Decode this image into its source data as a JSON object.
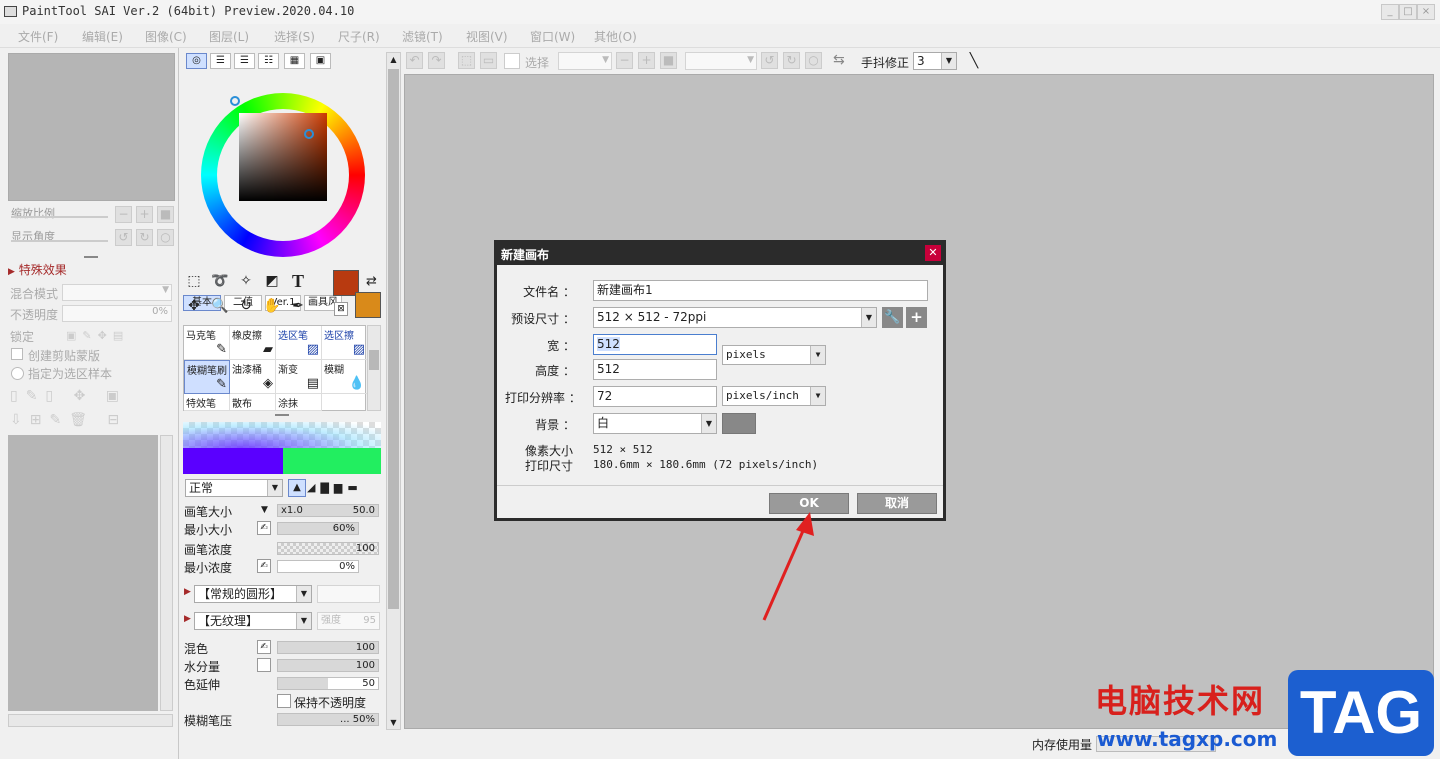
{
  "app": {
    "title": "PaintTool SAI Ver.2 (64bit) Preview.2020.04.10"
  },
  "menu": [
    "文件(F)",
    "编辑(E)",
    "图像(C)",
    "图层(L)",
    "选择(S)",
    "尺子(R)",
    "滤镜(T)",
    "视图(V)",
    "窗口(W)",
    "其他(O)"
  ],
  "left": {
    "zoom_label": "缩放比例",
    "angle_label": "显示角度",
    "special_effects": "特殊效果",
    "blend_mode": "混合模式",
    "opacity": "不透明度",
    "opacity_value": "0%",
    "lock": "锁定",
    "clip_mask": "创建剪贴蒙版",
    "sel_sample": "指定为选区样本"
  },
  "color_tabs": {
    "basic": "基本",
    "binary": "二值",
    "ver1": "Ver.1",
    "painter": "画具风"
  },
  "brushes": [
    {
      "label": "马克笔"
    },
    {
      "label": "橡皮擦"
    },
    {
      "label": "选区笔"
    },
    {
      "label": "选区擦"
    },
    {
      "label": "模糊笔刷"
    },
    {
      "label": "油漆桶"
    },
    {
      "label": "渐变"
    },
    {
      "label": "模糊"
    },
    {
      "label": "特效笔"
    },
    {
      "label": "散布"
    },
    {
      "label": "涂抹"
    }
  ],
  "brush_props": {
    "mode": "正常",
    "size_label": "画笔大小",
    "size_mult": "x1.0",
    "size_value": "50.0",
    "min_size_label": "最小大小",
    "min_size_value": "60%",
    "density_label": "画笔浓度",
    "density_value": "100",
    "min_density_label": "最小浓度",
    "min_density_value": "0%",
    "shape": "【常规的圆形】",
    "texture": "【无纹理】",
    "texture_strength_label": "强度",
    "texture_strength": "95",
    "blend_label": "混色",
    "blend_value": "100",
    "water_label": "水分量",
    "water_value": "100",
    "stretch_label": "色延伸",
    "stretch_value": "50",
    "keep_opacity": "保持不透明度",
    "blur_label": "模糊笔压",
    "blur_value": "... 50%"
  },
  "toolbar": {
    "select_label": "选择",
    "stabilizer_label": "手抖修正",
    "stabilizer_value": "3"
  },
  "status": {
    "memory": "内存使用量"
  },
  "dialog": {
    "title": "新建画布",
    "filename_label": "文件名",
    "filename": "新建画布1",
    "preset_label": "预设尺寸",
    "preset": "512 × 512 - 72ppi",
    "width_label": "宽",
    "width": "512",
    "height_label": "高度",
    "height": "512",
    "unit": "pixels",
    "resolution_label": "打印分辨率",
    "resolution": "72",
    "res_unit": "pixels/inch",
    "bg_label": "背景",
    "bg": "白",
    "pixel_size_label": "像素大小",
    "pixel_size": "512 × 512",
    "print_size_label": "打印尺寸",
    "print_size": "180.6mm × 180.6mm (72 pixels/inch)",
    "ok": "OK",
    "cancel": "取消"
  },
  "watermark": {
    "line1": "电脑技术网",
    "line2": "www.tagxp.com",
    "tag": "TAG"
  },
  "colors": {
    "primary": "#b83a10",
    "secondary": "#d98a1a",
    "dialog_title_bg": "#2b2b2b",
    "close_btn": "#c8003a",
    "arrow": "#e02020",
    "canvas_bg": "#c0c0c0"
  }
}
